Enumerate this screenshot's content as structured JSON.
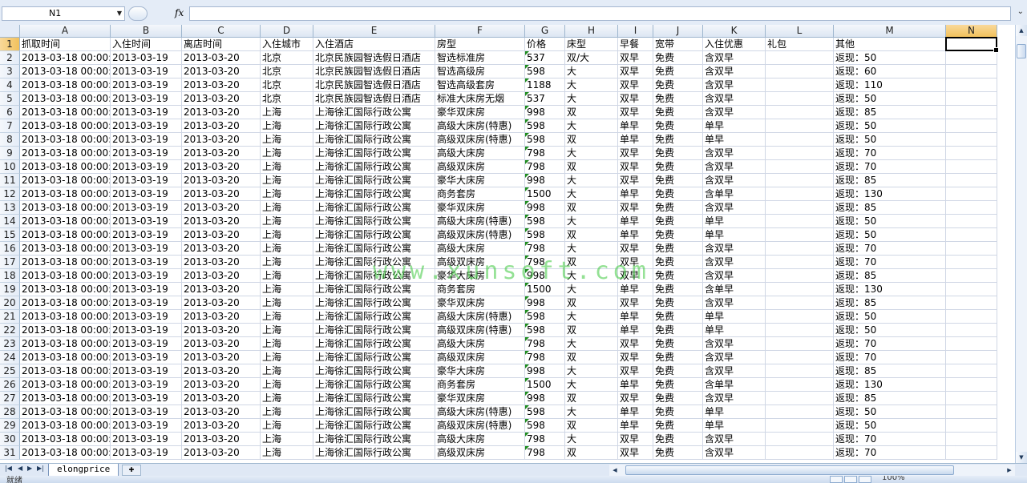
{
  "formula_bar": {
    "name_box": "N1",
    "fx_label": "fx",
    "formula": ""
  },
  "columns": [
    "A",
    "B",
    "C",
    "D",
    "E",
    "F",
    "G",
    "H",
    "I",
    "J",
    "K",
    "L",
    "M",
    "N"
  ],
  "active_cell": "N1",
  "header_row": [
    "抓取时间",
    "入住时间",
    "离店时间",
    "入住城市",
    "入住酒店",
    "房型",
    "价格",
    "床型",
    "早餐",
    "宽带",
    "入住优惠",
    "礼包",
    "其他",
    ""
  ],
  "rows": [
    [
      "2013-03-18 00:00:0",
      "2013-03-19",
      "2013-03-20",
      "北京",
      "北京民族园智选假日酒店",
      "智选标准房",
      "537",
      "双/大",
      "双早",
      "免费",
      "含双早",
      "",
      "返现：50"
    ],
    [
      "2013-03-18 00:00:0",
      "2013-03-19",
      "2013-03-20",
      "北京",
      "北京民族园智选假日酒店",
      "智选高级房",
      "598",
      "大",
      "双早",
      "免费",
      "含双早",
      "",
      "返现：60"
    ],
    [
      "2013-03-18 00:00:0",
      "2013-03-19",
      "2013-03-20",
      "北京",
      "北京民族园智选假日酒店",
      "智选高级套房",
      "1188",
      "大",
      "双早",
      "免费",
      "含双早",
      "",
      "返现：110"
    ],
    [
      "2013-03-18 00:00:0",
      "2013-03-19",
      "2013-03-20",
      "北京",
      "北京民族园智选假日酒店",
      "标准大床房无烟",
      "537",
      "大",
      "双早",
      "免费",
      "含双早",
      "",
      "返现：50"
    ],
    [
      "2013-03-18 00:00:0",
      "2013-03-19",
      "2013-03-20",
      "上海",
      "上海徐汇国际行政公寓",
      "豪华双床房",
      "998",
      "双",
      "双早",
      "免费",
      "含双早",
      "",
      "返现：85"
    ],
    [
      "2013-03-18 00:00:0",
      "2013-03-19",
      "2013-03-20",
      "上海",
      "上海徐汇国际行政公寓",
      "高级大床房(特惠)",
      "598",
      "大",
      "单早",
      "免费",
      "单早",
      "",
      "返现：50"
    ],
    [
      "2013-03-18 00:00:0",
      "2013-03-19",
      "2013-03-20",
      "上海",
      "上海徐汇国际行政公寓",
      "高级双床房(特惠)",
      "598",
      "双",
      "单早",
      "免费",
      "单早",
      "",
      "返现：50"
    ],
    [
      "2013-03-18 00:00:0",
      "2013-03-19",
      "2013-03-20",
      "上海",
      "上海徐汇国际行政公寓",
      "高级大床房",
      "798",
      "大",
      "双早",
      "免费",
      "含双早",
      "",
      "返现：70"
    ],
    [
      "2013-03-18 00:00:0",
      "2013-03-19",
      "2013-03-20",
      "上海",
      "上海徐汇国际行政公寓",
      "高级双床房",
      "798",
      "双",
      "双早",
      "免费",
      "含双早",
      "",
      "返现：70"
    ],
    [
      "2013-03-18 00:00:0",
      "2013-03-19",
      "2013-03-20",
      "上海",
      "上海徐汇国际行政公寓",
      "豪华大床房",
      "998",
      "大",
      "双早",
      "免费",
      "含双早",
      "",
      "返现：85"
    ],
    [
      "2013-03-18 00:00:0",
      "2013-03-19",
      "2013-03-20",
      "上海",
      "上海徐汇国际行政公寓",
      "商务套房",
      "1500",
      "大",
      "单早",
      "免费",
      "含单早",
      "",
      "返现：130"
    ],
    [
      "2013-03-18 00:00:0",
      "2013-03-19",
      "2013-03-20",
      "上海",
      "上海徐汇国际行政公寓",
      "豪华双床房",
      "998",
      "双",
      "双早",
      "免费",
      "含双早",
      "",
      "返现：85"
    ],
    [
      "2013-03-18 00:00:0",
      "2013-03-19",
      "2013-03-20",
      "上海",
      "上海徐汇国际行政公寓",
      "高级大床房(特惠)",
      "598",
      "大",
      "单早",
      "免费",
      "单早",
      "",
      "返现：50"
    ],
    [
      "2013-03-18 00:00:0",
      "2013-03-19",
      "2013-03-20",
      "上海",
      "上海徐汇国际行政公寓",
      "高级双床房(特惠)",
      "598",
      "双",
      "单早",
      "免费",
      "单早",
      "",
      "返现：50"
    ],
    [
      "2013-03-18 00:00:0",
      "2013-03-19",
      "2013-03-20",
      "上海",
      "上海徐汇国际行政公寓",
      "高级大床房",
      "798",
      "大",
      "双早",
      "免费",
      "含双早",
      "",
      "返现：70"
    ],
    [
      "2013-03-18 00:00:0",
      "2013-03-19",
      "2013-03-20",
      "上海",
      "上海徐汇国际行政公寓",
      "高级双床房",
      "798",
      "双",
      "双早",
      "免费",
      "含双早",
      "",
      "返现：70"
    ],
    [
      "2013-03-18 00:00:0",
      "2013-03-19",
      "2013-03-20",
      "上海",
      "上海徐汇国际行政公寓",
      "豪华大床房",
      "998",
      "大",
      "双早",
      "免费",
      "含双早",
      "",
      "返现：85"
    ],
    [
      "2013-03-18 00:00:0",
      "2013-03-19",
      "2013-03-20",
      "上海",
      "上海徐汇国际行政公寓",
      "商务套房",
      "1500",
      "大",
      "单早",
      "免费",
      "含单早",
      "",
      "返现：130"
    ],
    [
      "2013-03-18 00:00:0",
      "2013-03-19",
      "2013-03-20",
      "上海",
      "上海徐汇国际行政公寓",
      "豪华双床房",
      "998",
      "双",
      "双早",
      "免费",
      "含双早",
      "",
      "返现：85"
    ],
    [
      "2013-03-18 00:00:0",
      "2013-03-19",
      "2013-03-20",
      "上海",
      "上海徐汇国际行政公寓",
      "高级大床房(特惠)",
      "598",
      "大",
      "单早",
      "免费",
      "单早",
      "",
      "返现：50"
    ],
    [
      "2013-03-18 00:00:0",
      "2013-03-19",
      "2013-03-20",
      "上海",
      "上海徐汇国际行政公寓",
      "高级双床房(特惠)",
      "598",
      "双",
      "单早",
      "免费",
      "单早",
      "",
      "返现：50"
    ],
    [
      "2013-03-18 00:00:0",
      "2013-03-19",
      "2013-03-20",
      "上海",
      "上海徐汇国际行政公寓",
      "高级大床房",
      "798",
      "大",
      "双早",
      "免费",
      "含双早",
      "",
      "返现：70"
    ],
    [
      "2013-03-18 00:00:0",
      "2013-03-19",
      "2013-03-20",
      "上海",
      "上海徐汇国际行政公寓",
      "高级双床房",
      "798",
      "双",
      "双早",
      "免费",
      "含双早",
      "",
      "返现：70"
    ],
    [
      "2013-03-18 00:00:0",
      "2013-03-19",
      "2013-03-20",
      "上海",
      "上海徐汇国际行政公寓",
      "豪华大床房",
      "998",
      "大",
      "双早",
      "免费",
      "含双早",
      "",
      "返现：85"
    ],
    [
      "2013-03-18 00:00:0",
      "2013-03-19",
      "2013-03-20",
      "上海",
      "上海徐汇国际行政公寓",
      "商务套房",
      "1500",
      "大",
      "单早",
      "免费",
      "含单早",
      "",
      "返现：130"
    ],
    [
      "2013-03-18 00:00:0",
      "2013-03-19",
      "2013-03-20",
      "上海",
      "上海徐汇国际行政公寓",
      "豪华双床房",
      "998",
      "双",
      "双早",
      "免费",
      "含双早",
      "",
      "返现：85"
    ],
    [
      "2013-03-18 00:00:0",
      "2013-03-19",
      "2013-03-20",
      "上海",
      "上海徐汇国际行政公寓",
      "高级大床房(特惠)",
      "598",
      "大",
      "单早",
      "免费",
      "单早",
      "",
      "返现：50"
    ],
    [
      "2013-03-18 00:00:0",
      "2013-03-19",
      "2013-03-20",
      "上海",
      "上海徐汇国际行政公寓",
      "高级双床房(特惠)",
      "598",
      "双",
      "单早",
      "免费",
      "单早",
      "",
      "返现：50"
    ],
    [
      "2013-03-18 00:00:0",
      "2013-03-19",
      "2013-03-20",
      "上海",
      "上海徐汇国际行政公寓",
      "高级大床房",
      "798",
      "大",
      "双早",
      "免费",
      "含双早",
      "",
      "返现：70"
    ],
    [
      "2013-03-18 00:00:0",
      "2013-03-19",
      "2013-03-20",
      "上海",
      "上海徐汇国际行政公寓",
      "高级双床房",
      "798",
      "双",
      "双早",
      "免费",
      "含双早",
      "",
      "返现：70"
    ]
  ],
  "sheet_tab": "elongprice",
  "watermark": "www.xunsoft.com",
  "status": {
    "ready": "就绪",
    "zoom": "100%"
  },
  "colors": {
    "header_active": "#f1c15c",
    "grid_line": "#d0d7e5",
    "text_number_marker": "#1e8c1e",
    "watermark": "#3cc83c"
  }
}
